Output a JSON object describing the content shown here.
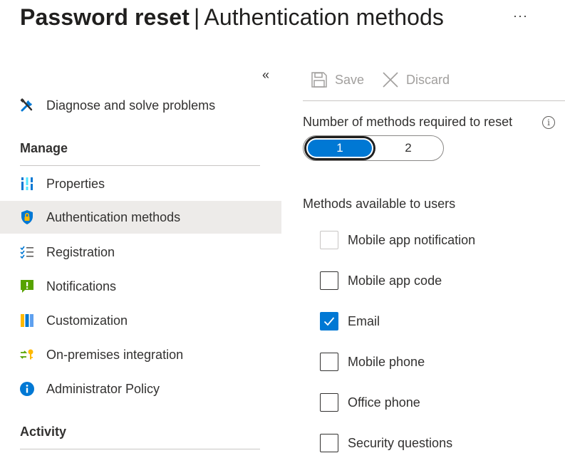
{
  "header": {
    "title_bold": "Password reset",
    "separator": "|",
    "title_sub": "Authentication methods",
    "more_label": "···"
  },
  "sidebar": {
    "collapse_label": "«",
    "top_item": {
      "label": "Diagnose and solve problems",
      "icon": "wrench-screwdriver-icon"
    },
    "section_manage": "Manage",
    "items": [
      {
        "label": "Properties",
        "icon": "properties-icon"
      },
      {
        "label": "Authentication methods",
        "icon": "shield-lock-icon",
        "active": true
      },
      {
        "label": "Registration",
        "icon": "checklist-icon"
      },
      {
        "label": "Notifications",
        "icon": "notification-icon"
      },
      {
        "label": "Customization",
        "icon": "customization-icon"
      },
      {
        "label": "On-premises integration",
        "icon": "sync-key-icon"
      },
      {
        "label": "Administrator Policy",
        "icon": "info-icon"
      }
    ],
    "section_activity": "Activity"
  },
  "toolbar": {
    "save_label": "Save",
    "discard_label": "Discard"
  },
  "main": {
    "methods_required_label": "Number of methods required to reset",
    "methods_required_options": [
      "1",
      "2"
    ],
    "methods_required_selected": "1",
    "methods_available_label": "Methods available to users",
    "methods": [
      {
        "label": "Mobile app notification",
        "checked": false,
        "disabled": true
      },
      {
        "label": "Mobile app code",
        "checked": false,
        "disabled": false
      },
      {
        "label": "Email",
        "checked": true,
        "disabled": false
      },
      {
        "label": "Mobile phone",
        "checked": false,
        "disabled": false
      },
      {
        "label": "Office phone",
        "checked": false,
        "disabled": false
      },
      {
        "label": "Security questions",
        "checked": false,
        "disabled": false
      }
    ]
  },
  "colors": {
    "accent": "#0078d4",
    "active_nav_bg": "#edebe9",
    "disabled_text": "#a19f9d"
  }
}
